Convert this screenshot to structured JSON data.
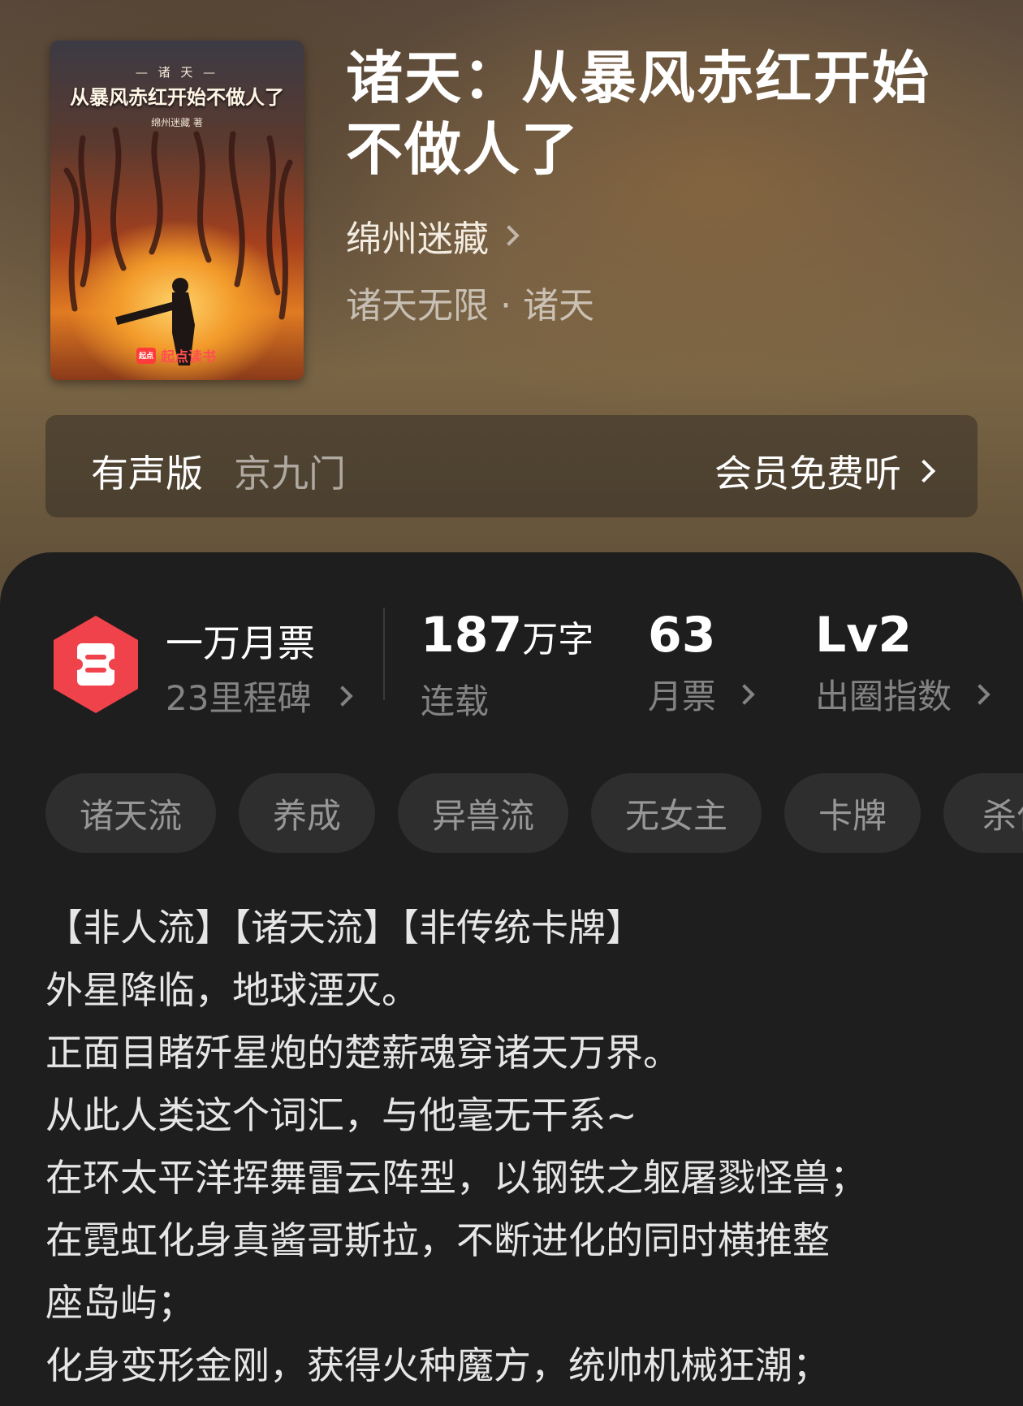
{
  "book": {
    "title": "诸天：从暴风赤红开始不做人了",
    "author": "绵州迷藏",
    "category": "诸天无限 · 诸天"
  },
  "cover": {
    "series": "— 诸 天 —",
    "title": "从暴风赤红开始不做人了",
    "author": "绵州迷藏 著",
    "brand": "起点读书",
    "brand_icon": "起点"
  },
  "audio": {
    "label": "有声版",
    "narrator": "京九门",
    "cta": "会员免费听"
  },
  "ticket": {
    "title": "一万月票",
    "milestone": "23里程碑",
    "badge_color": "#f0424a"
  },
  "stats": {
    "words_value": "187",
    "words_unit": "万字",
    "words_label": "连载",
    "votes_value": "63",
    "votes_label": "月票",
    "level_value": "Lv2",
    "level_label": "出圈指数"
  },
  "tags": [
    "诸天流",
    "养成",
    "异兽流",
    "无女主",
    "卡牌",
    "杀伐"
  ],
  "synopsis": [
    "【非人流】【诸天流】【非传统卡牌】",
    "外星降临，地球湮灭。",
    "正面目睹歼星炮的楚薪魂穿诸天万界。",
    "从此人类这个词汇，与他毫无干系~",
    "在环太平洋挥舞雷云阵型，以钢铁之躯屠戮怪兽；",
    "在霓虹化身真酱哥斯拉，不断进化的同时横推整",
    "座岛屿；",
    "化身变形金刚，获得火种魔方，统帅机械狂潮；"
  ]
}
